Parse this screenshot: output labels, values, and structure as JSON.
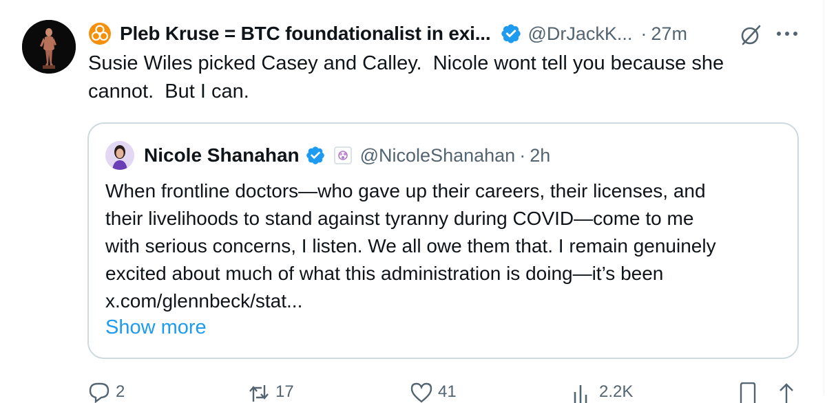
{
  "tweet": {
    "display_name": "Pleb Kruse = BTC foundationalist in exi...",
    "handle": "@DrJackK...",
    "separator": "·",
    "time": "27m",
    "text": "Susie Wiles picked Casey and Calley.  Nicole wont tell you because she\ncannot.  But I can."
  },
  "quote": {
    "display_name": "Nicole Shanahan",
    "handle": "@NicoleShanahan",
    "separator": "·",
    "time": "2h",
    "text": "When frontline doctors—who gave up their careers, their licenses, and\ntheir livelihoods to stand against tyranny during COVID—come to me\nwith serious concerns, I listen. We all owe them that. I remain genuinely\nexcited about much of what this administration is doing—it’s been\nx.com/glennbeck/stat...",
    "show_more": "Show more"
  },
  "actions": {
    "replies": "2",
    "reposts": "17",
    "likes": "41",
    "views": "2.2K"
  },
  "icons": {
    "biohazard": "biohazard-icon",
    "verified": "verified-badge-icon",
    "grok": "grok-icon",
    "more": "more-icon",
    "affiliate": "affiliate-badge-icon",
    "reply": "reply-icon",
    "repost": "repost-icon",
    "like": "like-icon",
    "views": "views-icon",
    "bookmark": "bookmark-icon",
    "share": "share-icon"
  },
  "colors": {
    "accent": "#1d9bf0",
    "secondary_text": "#536471",
    "border": "#cfd9de",
    "biohazard": "#f4900c"
  }
}
